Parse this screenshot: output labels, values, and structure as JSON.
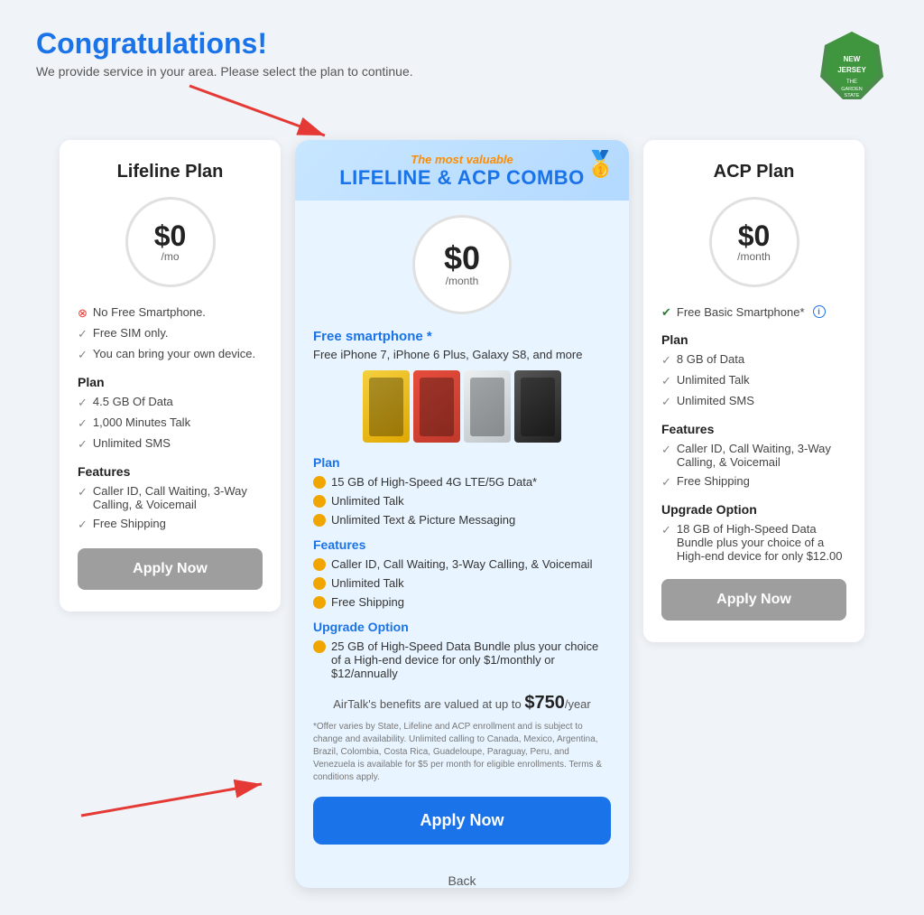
{
  "header": {
    "title": "Congratulations!",
    "subtitle": "We provide service in your area. Please select the plan to continue."
  },
  "lifeline": {
    "title": "Lifeline Plan",
    "price": "$0",
    "per": "/mo",
    "features_intro": [
      {
        "icon": "x",
        "text": "No Free Smartphone."
      },
      {
        "icon": "check",
        "text": "Free SIM only."
      },
      {
        "icon": "check",
        "text": "You can bring your own device."
      }
    ],
    "plan_label": "Plan",
    "plan_features": [
      {
        "text": "4.5 GB Of Data"
      },
      {
        "text": "1,000 Minutes Talk"
      },
      {
        "text": "Unlimited SMS"
      }
    ],
    "features_label": "Features",
    "features": [
      {
        "text": "Caller ID, Call Waiting, 3-Way Calling, & Voicemail"
      },
      {
        "text": "Free Shipping"
      }
    ],
    "apply_btn": "Apply Now"
  },
  "combo": {
    "most_valuable": "The most valuable",
    "title": "LIFELINE & ACP COMBO",
    "price": "$0",
    "per": "/month",
    "free_smartphone_label": "Free smartphone *",
    "free_smartphone_desc": "Free iPhone 7, iPhone 6 Plus, Galaxy S8, and more",
    "plan_label": "Plan",
    "plan_features": [
      {
        "text": "15 GB of High-Speed 4G LTE/5G Data*"
      },
      {
        "text": "Unlimited Talk"
      },
      {
        "text": "Unlimited Text & Picture Messaging"
      }
    ],
    "features_label": "Features",
    "features": [
      {
        "text": "Caller ID, Call Waiting, 3-Way Calling, & Voicemail"
      },
      {
        "text": "Unlimited Talk"
      },
      {
        "text": "Free Shipping"
      }
    ],
    "upgrade_label": "Upgrade Option",
    "upgrade_features": [
      {
        "text": "25 GB of High-Speed Data Bundle plus your choice of a High-end device for only $1/monthly or $12/annually"
      }
    ],
    "airtalk_text": "AirTalk's benefits are valued at up to",
    "airtalk_value": "$750",
    "airtalk_per": "/year",
    "disclaimer": "*Offer varies by State, Lifeline and ACP enrollment and is subject to change and availability. Unlimited calling to Canada, Mexico, Argentina, Brazil, Colombia, Costa Rica, Guadeloupe, Paraguay, Peru, and Venezuela is available for $5 per month for eligible enrollments. Terms & conditions apply.",
    "apply_btn": "Apply Now",
    "back_label": "Back"
  },
  "acp": {
    "title": "ACP Plan",
    "price": "$0",
    "per": "/month",
    "free_smartphone": "Free Basic Smartphone*",
    "plan_label": "Plan",
    "plan_features": [
      {
        "text": "8 GB of Data"
      },
      {
        "text": "Unlimited Talk"
      },
      {
        "text": "Unlimited SMS"
      }
    ],
    "features_label": "Features",
    "features": [
      {
        "text": "Caller ID, Call Waiting, 3-Way Calling, & Voicemail"
      },
      {
        "text": "Free Shipping"
      }
    ],
    "upgrade_label": "Upgrade Option",
    "upgrade_features": [
      {
        "text": "18 GB of High-Speed Data Bundle plus your choice of a High-end device for only $12.00"
      }
    ],
    "apply_btn": "Apply Now"
  }
}
